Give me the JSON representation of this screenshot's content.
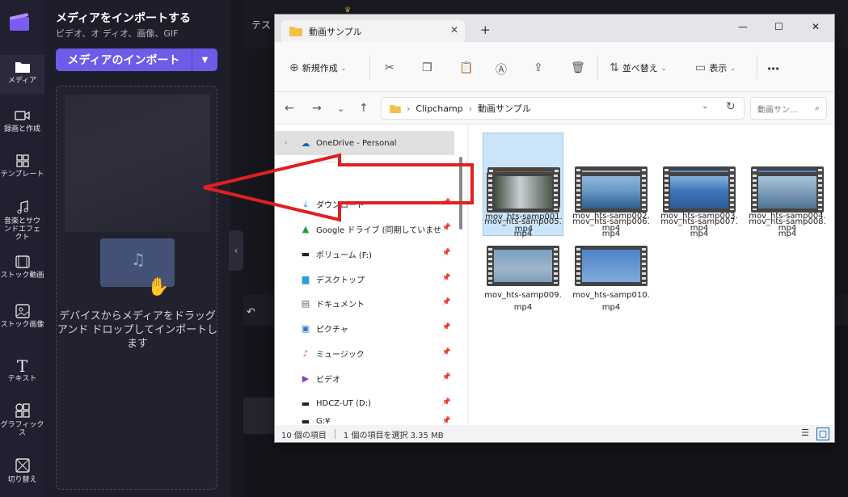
{
  "rail": {
    "items": [
      {
        "label": "メディア",
        "icon": "folder-icon"
      },
      {
        "label": "録画と作成",
        "icon": "camera-icon"
      },
      {
        "label": "テンプレート",
        "icon": "template-icon"
      },
      {
        "label": "音楽とサウンドエフェクト",
        "icon": "music-icon"
      },
      {
        "label": "ストック動画",
        "icon": "film-icon"
      },
      {
        "label": "ストック画像",
        "icon": "image-icon"
      },
      {
        "label": "テキスト",
        "icon": "text-icon"
      },
      {
        "label": "グラフィックス",
        "icon": "shapes-icon"
      },
      {
        "label": "切り替え",
        "icon": "transition-icon"
      }
    ]
  },
  "media_panel": {
    "title": "メディアをインポートする",
    "subtitle": "ビデオ、オ ディオ、画像、GIF",
    "import_button": "メディアのインポート",
    "drop_text": "デバイスからメディアをドラッグ アンド ドロップしてインポートします"
  },
  "editor": {
    "tab": "テス"
  },
  "explorer": {
    "tab_title": "動画サンプル",
    "toolbar": {
      "new": "新規作成",
      "sort": "並べ替え",
      "view": "表示"
    },
    "breadcrumb": [
      "Clipchamp",
      "動画サンプル"
    ],
    "search_placeholder": "動画サン...",
    "nav_items": [
      {
        "label": "OneDrive - Personal",
        "icon": "cloud-icon",
        "pinned": false
      },
      {
        "label": "ダウンロード",
        "icon": "download-icon",
        "pinned": true
      },
      {
        "label": "Google ドライブ (同期していませ",
        "icon": "drive-icon",
        "pinned": true
      },
      {
        "label": "ボリューム (F:)",
        "icon": "drive-icon",
        "pinned": true
      },
      {
        "label": "デスクトップ",
        "icon": "desktop-icon",
        "pinned": true
      },
      {
        "label": "ドキュメント",
        "icon": "document-icon",
        "pinned": true
      },
      {
        "label": "ピクチャ",
        "icon": "picture-icon",
        "pinned": true
      },
      {
        "label": "ミュージック",
        "icon": "music-icon",
        "pinned": true
      },
      {
        "label": "ビデオ",
        "icon": "video-icon",
        "pinned": true
      },
      {
        "label": "HDCZ-UT (D:)",
        "icon": "drive-icon",
        "pinned": true
      },
      {
        "label": "G:¥",
        "icon": "drive-icon",
        "pinned": true
      }
    ],
    "files": [
      {
        "name": "mov_hts-samp001.mp4",
        "selected": true,
        "thumb": "church"
      },
      {
        "name": "mov_hts-samp002.mp4",
        "selected": false,
        "thumb": "chapel"
      },
      {
        "name": "mov_hts-samp003.mp4",
        "selected": false,
        "thumb": "tree"
      },
      {
        "name": "mov_hts-samp004.mp4",
        "selected": false,
        "thumb": "branches"
      },
      {
        "name": "mov_hts-samp005.mp4",
        "selected": false,
        "thumb": "waterfall"
      },
      {
        "name": "mov_hts-samp006.mp4",
        "selected": false,
        "thumb": "sea"
      },
      {
        "name": "mov_hts-samp007.mp4",
        "selected": false,
        "thumb": "wake"
      },
      {
        "name": "mov_hts-samp008.mp4",
        "selected": false,
        "thumb": "island"
      },
      {
        "name": "mov_hts-samp009.mp4",
        "selected": false,
        "thumb": "sky"
      },
      {
        "name": "mov_hts-samp010.mp4",
        "selected": false,
        "thumb": "plane"
      }
    ],
    "status": {
      "count": "10 個の項目",
      "selection": "1 個の項目を選択  3.35 MB"
    }
  },
  "colors": {
    "accent": "#6c5ce7",
    "arrow": "#e02020",
    "selection": "#cce4f7"
  }
}
